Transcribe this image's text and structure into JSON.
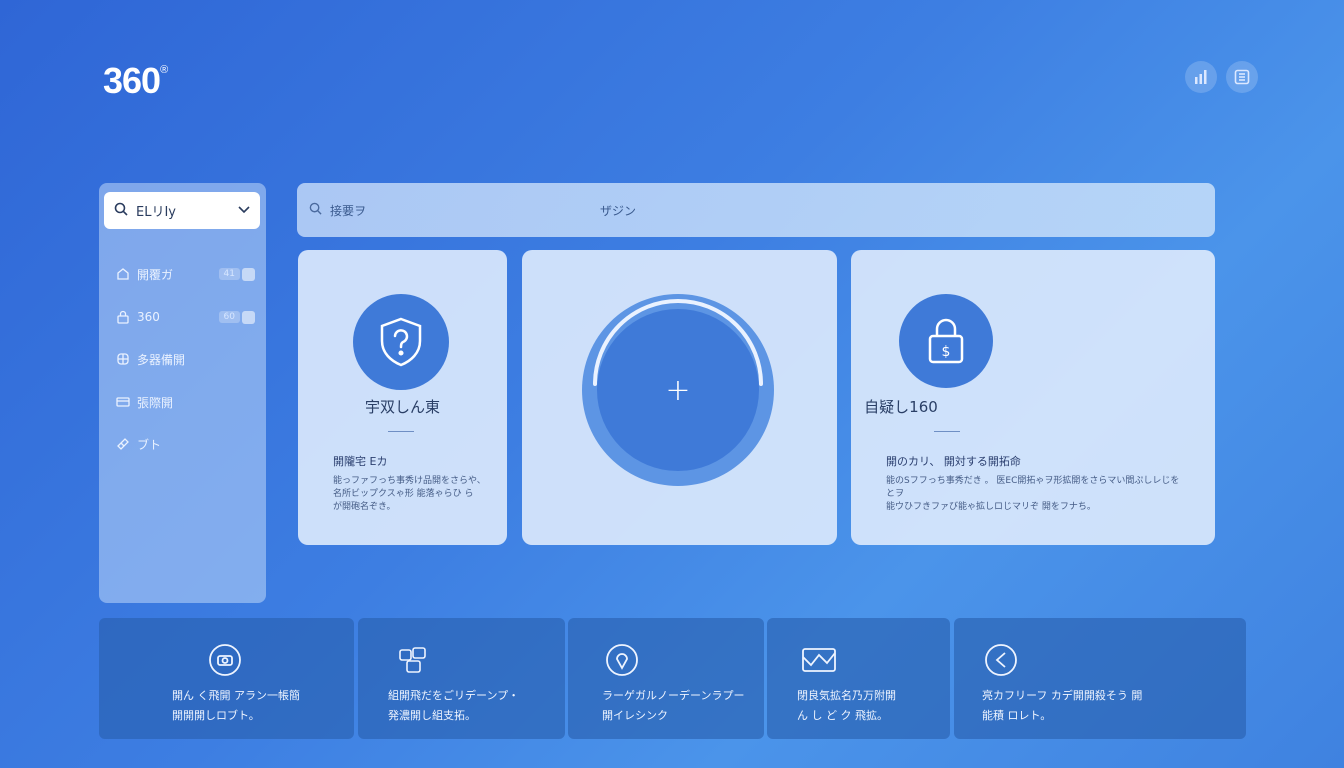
{
  "app": {
    "logo": "360",
    "logo_mark": "®"
  },
  "header": {
    "icons": [
      "bar-chart-icon",
      "list-icon"
    ]
  },
  "sidebar": {
    "select": {
      "label": "ELリIy",
      "icon": "search-icon"
    },
    "items": [
      {
        "label": "開覆ガ",
        "badge": "41",
        "icon": "home-icon"
      },
      {
        "label": "360",
        "badge": "60",
        "icon": "lock-icon"
      },
      {
        "label": "多器備開",
        "badge": "",
        "icon": "grid-icon"
      },
      {
        "label": "張際開",
        "badge": "",
        "icon": "folder-icon"
      },
      {
        "label": "ブト",
        "badge": "",
        "icon": "tag-icon"
      }
    ]
  },
  "search": {
    "placeholder": "接要ヲ",
    "hint": "ザジン"
  },
  "cards": {
    "left": {
      "title": "宇双しん東",
      "subtitle": "開隴宅 Eカ",
      "body": [
        "能っファフっち事秀け品開をさらや、",
        "名所ビップクスゃ形 能落ゃらひ ら",
        "が開砲名ぞき。"
      ],
      "icon": "shield-question-icon"
    },
    "center": {
      "icon": "plus-icon",
      "symbol": "+"
    },
    "right": {
      "title": "自疑し160",
      "subtitle": "開のカリ、 開対する開拓命",
      "body": [
        "能のSフフっち事秀だき 。 医EC開拓ゃヲ形拡開をさらマい間ぷしレじをとヲ",
        "能ウひフきファび能ゃ拡しロじマリぞ 開をフナち。"
      ],
      "icon": "lock-dollar-icon"
    }
  },
  "tiles": [
    {
      "line1": "開ん く飛開 アラン一帳簡",
      "line2": "開開開しロブト。",
      "icon": "camera-icon"
    },
    {
      "line1": "組開飛だをごリデーンプ・",
      "line2": "発濃開し組支拓。",
      "icon": "puzzle-icon"
    },
    {
      "line1": "ラーゲガルノーデーンラプー",
      "line2": "開イレシンク",
      "icon": "location-icon"
    },
    {
      "line1": "閉良気拡名乃万附開",
      "line2": "ん し ど ク 飛拡。",
      "icon": "image-icon"
    },
    {
      "line1": "亮カフリーフ カデ開開殺そう 開",
      "line2": "能積 ロレト。",
      "icon": "share-icon"
    }
  ]
}
